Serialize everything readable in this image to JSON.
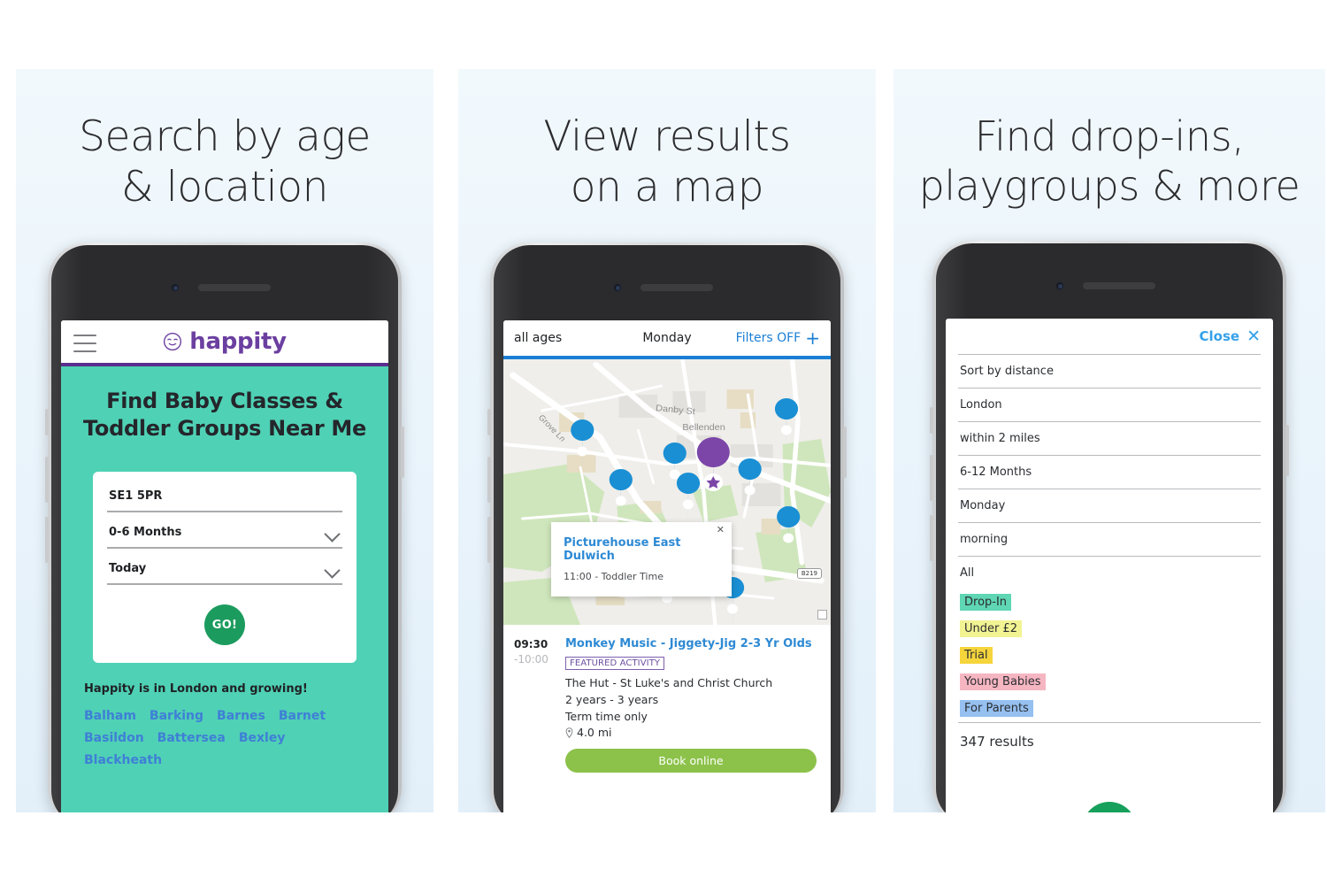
{
  "panels": [
    {
      "heading": "Search by age\n& location"
    },
    {
      "heading": "View results\non a map"
    },
    {
      "heading": "Find drop-ins,\nplaygroups & more"
    }
  ],
  "screen1": {
    "menu_icon": "hamburger-icon",
    "logo_icon": "happity-baby-face-icon",
    "logo_text": "happity",
    "hero_title": "Find Baby Classes & Toddler Groups Near Me",
    "form": {
      "postcode_value": "SE1 5PR",
      "age_value": "0-6 Months",
      "day_value": "Today",
      "go_label": "GO!"
    },
    "growing_text": "Happity is in London and growing!",
    "places": [
      "Balham",
      "Barking",
      "Barnes",
      "Barnet",
      "Basildon",
      "Battersea",
      "Bexley",
      "Blackheath"
    ],
    "colors": {
      "hero_bg": "#4fd1b5",
      "brand_purple": "#5b2d8e",
      "go_green": "#1c9b5e",
      "link_blue": "#3f7fd6"
    }
  },
  "screen2": {
    "tabs": {
      "ages": "all ages",
      "day": "Monday",
      "filters": "Filters OFF",
      "filters_icon": "plus-icon"
    },
    "map": {
      "labels": [
        "Grove Ln",
        "Danby St",
        "Bellenden"
      ],
      "road_badge": "B219",
      "popup": {
        "title": "Picturehouse East Dulwich",
        "subtitle": "11:00 - Toddler Time",
        "close_icon": "close-x-icon"
      }
    },
    "listing": {
      "time_start": "09:30",
      "time_end": "-10:00",
      "name": "Monkey Music - Jiggety-Jig 2-3 Yr Olds",
      "badge": "FEATURED ACTIVITY",
      "venue": "The Hut - St Luke's and Christ Church",
      "ages": "2 years - 3 years",
      "term": "Term time only",
      "distance": "4.0 mi",
      "distance_icon": "map-pin-icon",
      "book_label": "Book online"
    },
    "colors": {
      "tab_underline": "#1a7fd4",
      "link_blue": "#2e8ad4",
      "book_green": "#8cc24a",
      "badge_purple": "#6b4fa0"
    }
  },
  "screen3": {
    "close_label": "Close",
    "close_icon": "close-x-icon",
    "rows": [
      "Sort by distance",
      "London",
      "within 2 miles",
      "6-12 Months",
      "Monday",
      "morning",
      "All"
    ],
    "tags": [
      {
        "label": "Drop-In",
        "color": "#5fd6b4"
      },
      {
        "label": "Under £2",
        "color": "#f2f392"
      },
      {
        "label": "Trial",
        "color": "#f6d53c"
      },
      {
        "label": "Young Babies",
        "color": "#f5b6c2"
      },
      {
        "label": "For Parents",
        "color": "#95c0f0"
      }
    ],
    "results": "347 results",
    "colors": {
      "link_blue": "#35a1e8",
      "fab_green": "#16a05c"
    }
  }
}
